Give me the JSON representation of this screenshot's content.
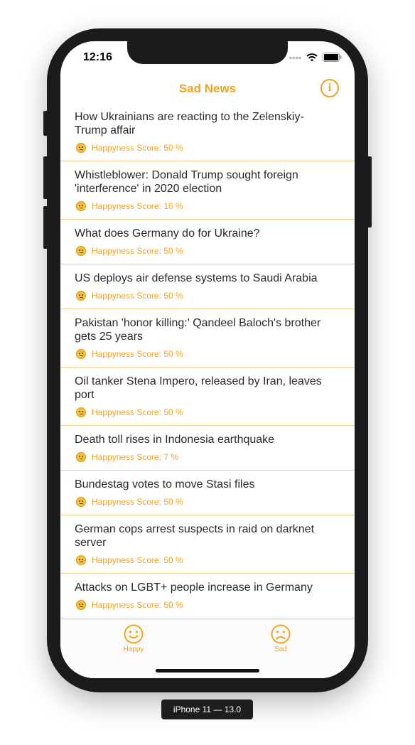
{
  "status": {
    "time": "12:16"
  },
  "nav": {
    "title": "Sad News",
    "info_icon": "i"
  },
  "articles": [
    {
      "title": "How Ukrainians are reacting to the Zelenskiy-Trump affair",
      "score": "Happyness Score: 50 %",
      "mood": "neutral"
    },
    {
      "title": "Whistleblower: Donald Trump sought foreign 'interference' in 2020 election",
      "score": "Happyness Score: 16 %",
      "mood": "sad"
    },
    {
      "title": "What does Germany do for Ukraine?",
      "score": "Happyness Score: 50 %",
      "mood": "neutral"
    },
    {
      "title": "US deploys air defense systems to Saudi Arabia",
      "score": "Happyness Score: 50 %",
      "mood": "neutral"
    },
    {
      "title": "Pakistan 'honor killing:' Qandeel Baloch's brother gets 25 years",
      "score": "Happyness Score: 50 %",
      "mood": "neutral"
    },
    {
      "title": "Oil tanker Stena Impero, released by Iran, leaves port",
      "score": "Happyness Score: 50 %",
      "mood": "neutral"
    },
    {
      "title": "Death toll rises in Indonesia earthquake",
      "score": "Happyness Score: 7 %",
      "mood": "sad"
    },
    {
      "title": "Bundestag votes to move Stasi files",
      "score": "Happyness Score: 50 %",
      "mood": "neutral"
    },
    {
      "title": "German cops arrest suspects in raid on darknet server",
      "score": "Happyness Score: 50 %",
      "mood": "neutral"
    },
    {
      "title": "Attacks on LGBT+ people increase in Germany",
      "score": "Happyness Score: 50 %",
      "mood": "neutral"
    }
  ],
  "tabs": {
    "happy": "Happy",
    "sad": "Sad"
  },
  "device_label": "iPhone 11 — 13.0",
  "colors": {
    "accent": "#f7a21b",
    "separator": "#f8cf8c"
  }
}
